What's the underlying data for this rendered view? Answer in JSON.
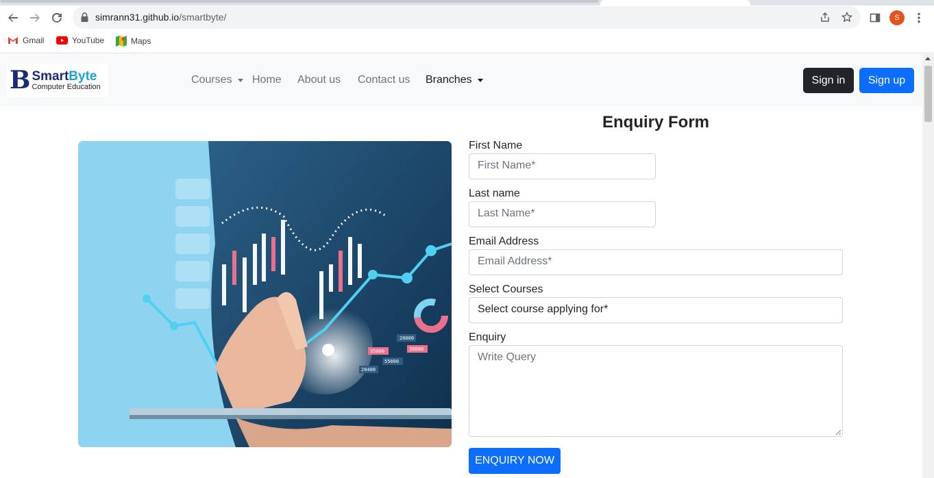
{
  "browser": {
    "url_host": "simrann31.github.io",
    "url_path": "/smartbyte/",
    "profile_initial": "S",
    "bookmarks": [
      {
        "label": "Gmail",
        "icon": "gmail-icon"
      },
      {
        "label": "YouTube",
        "icon": "youtube-icon"
      },
      {
        "label": "Maps",
        "icon": "maps-icon"
      }
    ]
  },
  "navbar": {
    "logo_letter": "B",
    "logo_name_a": "Smart",
    "logo_name_b": "Byte",
    "logo_tagline": "Computer Education",
    "items": [
      {
        "label": "Courses",
        "dropdown": true
      },
      {
        "label": "Home"
      },
      {
        "label": "About us"
      },
      {
        "label": "Contact us"
      },
      {
        "label": "Branches",
        "dropdown": true
      }
    ],
    "signin_label": "Sign in",
    "signup_label": "Sign up"
  },
  "form": {
    "title": "Enquiry Form",
    "first_name_label": "First Name",
    "first_name_placeholder": "First Name*",
    "last_name_label": "Last name",
    "last_name_placeholder": "Last Name*",
    "email_label": "Email Address",
    "email_placeholder": "Email Address*",
    "courses_label": "Select Courses",
    "courses_selected": "Select course applying for*",
    "enquiry_label": "Enquiry",
    "enquiry_placeholder": "Write Query",
    "submit_label": "ENQUIRY NOW"
  },
  "hero_chart_labels": [
    "20000",
    "30000",
    "35000",
    "55000",
    "20400"
  ],
  "colors": {
    "primary": "#0d6efd",
    "dark": "#212529",
    "navbar_bg": "#f8f9fa",
    "hero_bg": "#8ed3ef"
  }
}
